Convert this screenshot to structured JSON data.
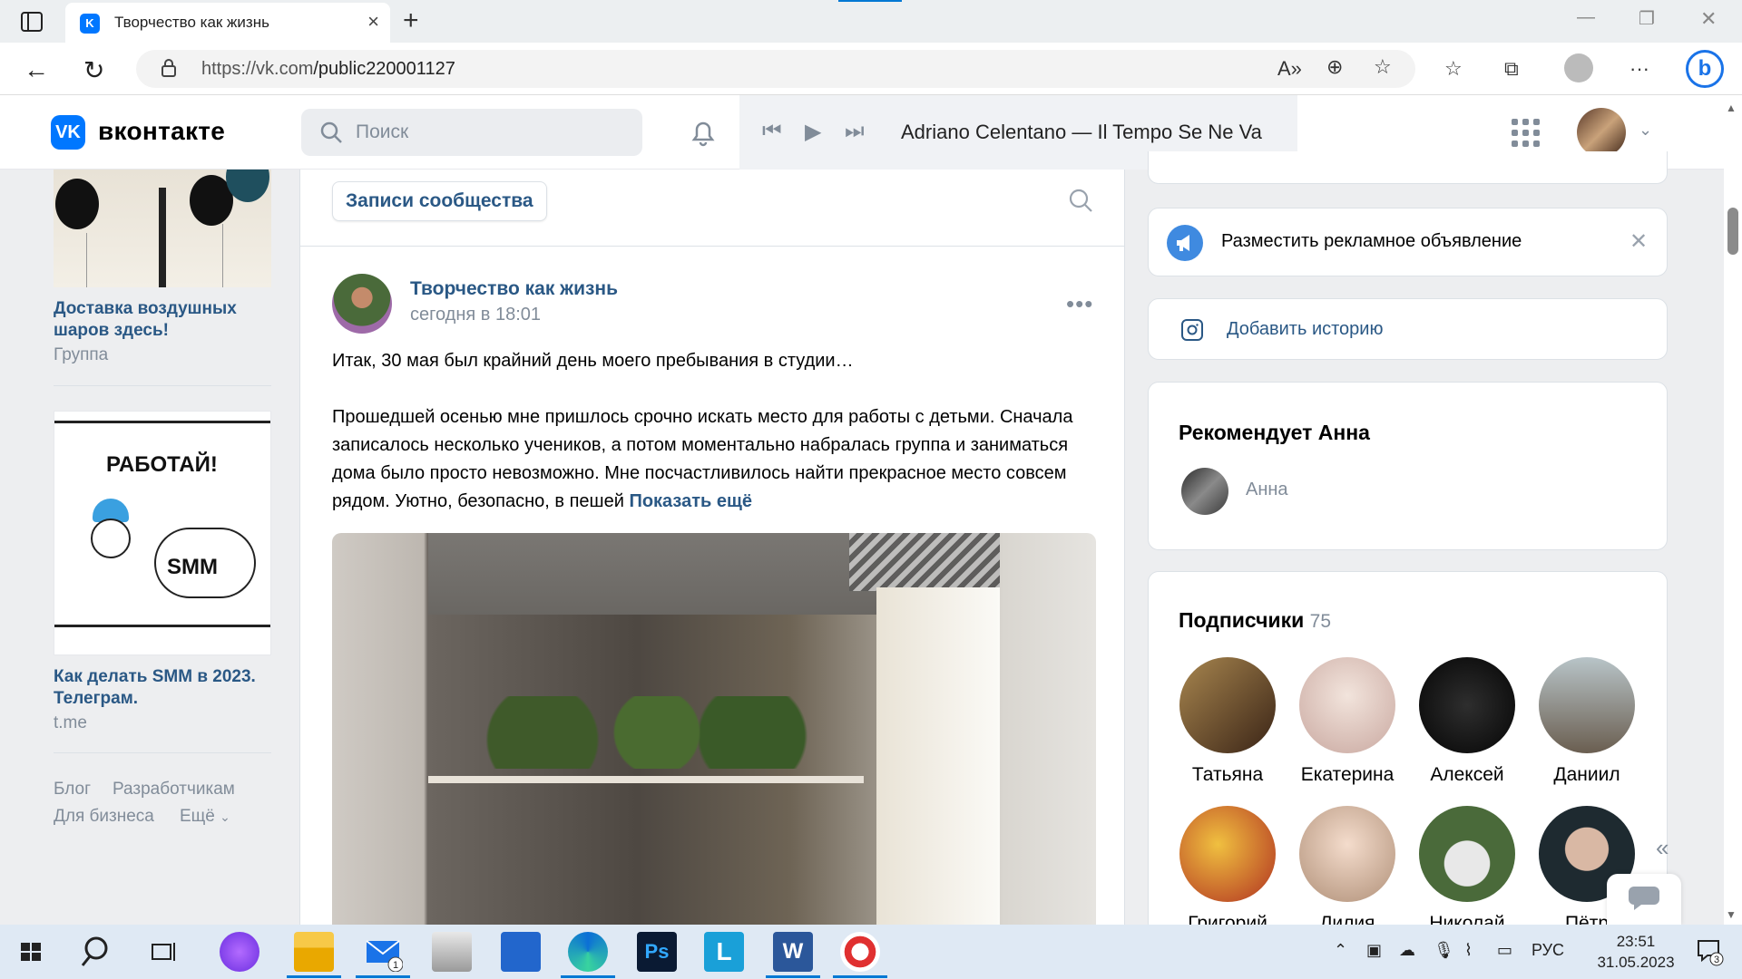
{
  "browser": {
    "tab_title": "Творчество как жизнь",
    "tab_favicon": "vk-favicon-icon",
    "url_host": "https://vk.com",
    "url_path": "/public220001127"
  },
  "vk_header": {
    "brand": "вконтакте",
    "search_placeholder": "Поиск",
    "now_playing": "Adriano Celentano — Il Tempo Se Ne Va"
  },
  "left_column": {
    "ads": [
      {
        "title": "Доставка воздушных шаров здесь!",
        "subtitle": "Группа"
      },
      {
        "title": "Как делать SMM в 2023. Телеграм.",
        "subtitle": "t.me",
        "image_text_1": "РАБОТАЙ!",
        "image_text_2": "SMM"
      }
    ],
    "footer_links": [
      "Блог",
      "Разработчикам",
      "Для бизнеса",
      "Ещё"
    ]
  },
  "post": {
    "filter_label": "Записи сообщества",
    "author": "Творчество как жизнь",
    "date": "сегодня в 18:01",
    "paragraph1": "Итак, 30 мая был крайний день моего пребывания в студии…",
    "paragraph2": "Прошедшей осенью мне пришлось срочно искать место для работы с детьми. Сначала записалось несколько учеников, а потом моментально набралась группа и заниматься дома было просто невозможно. Мне посчастливилось найти прекрасное место совсем рядом. Уютно, безопасно, в пешей",
    "show_more": "Показать ещё"
  },
  "right_column": {
    "ad_prompt": "Разместить рекламное объявление",
    "add_story": "Добавить историю",
    "recommends_title": "Рекомендует Анна",
    "recommends_name": "Анна",
    "subscribers_title": "Подписчики",
    "subscribers_count": "75",
    "subscribers": [
      {
        "name": "Татьяна",
        "color": "#8a6a48"
      },
      {
        "name": "Екатерина",
        "color": "#e8d8d0"
      },
      {
        "name": "Алексей",
        "color": "#151515"
      },
      {
        "name": "Даниил",
        "color": "#9aa4a8"
      },
      {
        "name": "Григорий",
        "color": "#d8a040"
      },
      {
        "name": "Лилия",
        "color": "#e6c8b4"
      },
      {
        "name": "Николай",
        "color": "#4a6a3a"
      },
      {
        "name": "Пётр",
        "color": "#2b3e4a"
      }
    ]
  },
  "taskbar": {
    "language": "РУС",
    "time": "23:51",
    "date": "31.05.2023",
    "notifications": "3",
    "mail_badge": "1"
  }
}
